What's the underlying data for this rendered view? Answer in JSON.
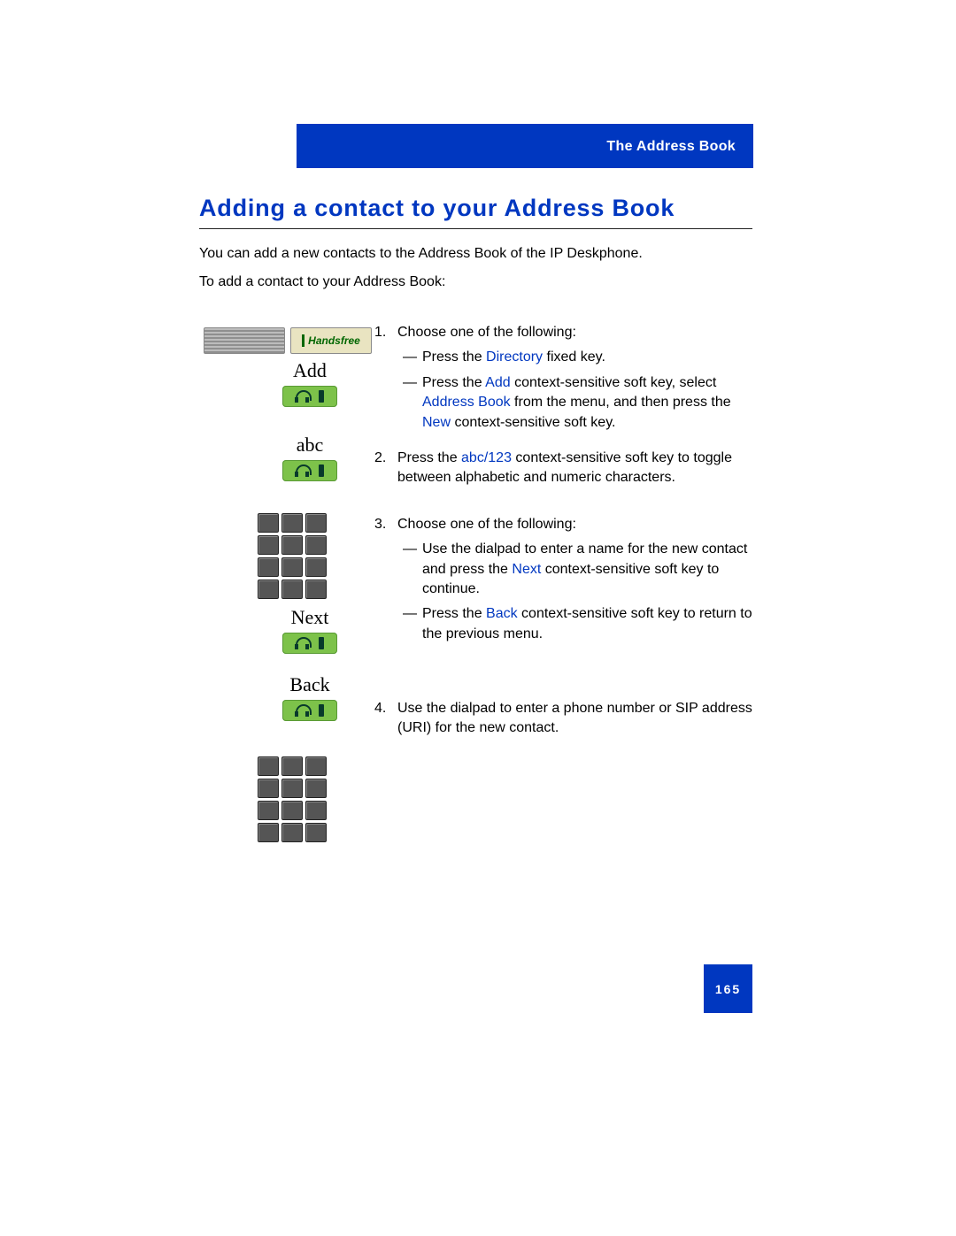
{
  "header": {
    "chapter": "The Address Book"
  },
  "heading": "Adding a contact to your Address Book",
  "intro": "You can add a new contacts to the Address Book of the IP Deskphone.",
  "lead": "To add a contact to your Address Book:",
  "softkeys": {
    "handsfree": "Handsfree",
    "add": "Add",
    "abc": "abc",
    "next": "Next",
    "back": "Back"
  },
  "steps": {
    "s1": {
      "num": "1.",
      "lead": "Choose one of the following:",
      "a": {
        "t1": "Press the ",
        "link": "Directory",
        "t2": "  fixed key."
      },
      "b": {
        "t1": "Press the ",
        "link1": "Add",
        "t2": " context-sensitive soft key, select ",
        "link2": "Address Book",
        "t3": "  from the menu, and then press the ",
        "link3": "New",
        "t4": " context-sensitive soft key."
      }
    },
    "s2": {
      "num": "2.",
      "t1": "Press the ",
      "link": "abc/123",
      "t2": " context-sensitive soft key to toggle between alphabetic and numeric characters."
    },
    "s3": {
      "num": "3.",
      "lead": "Choose one of the following:",
      "a": {
        "t1": "Use the dialpad to enter a name for the new contact and press the ",
        "link": "Next",
        "t2": " context-sensitive soft key to continue."
      },
      "b": {
        "t1": "Press the ",
        "link": "Back",
        "t2": " context-sensitive soft key to return to the previous menu."
      }
    },
    "s4": {
      "num": "4.",
      "text": "Use the dialpad to enter a phone number or SIP address (URI) for the new contact."
    }
  },
  "page_number": "165"
}
